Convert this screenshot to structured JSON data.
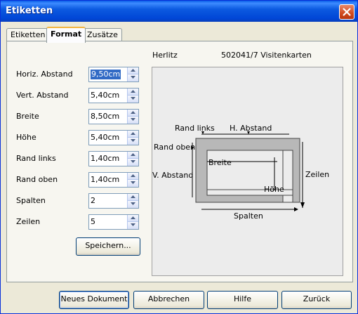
{
  "window": {
    "title": "Etiketten"
  },
  "tabs": [
    {
      "label": "Etiketten"
    },
    {
      "label": "Format"
    },
    {
      "label": "Zusätze"
    }
  ],
  "header": {
    "brand": "Herlitz",
    "product": "502041/7 Visitenkarten"
  },
  "fields": [
    {
      "label": "Horiz. Abstand",
      "value": "9,50cm"
    },
    {
      "label": "Vert. Abstand",
      "value": "5,40cm"
    },
    {
      "label": "Breite",
      "value": "8,50cm"
    },
    {
      "label": "Höhe",
      "value": "5,40cm"
    },
    {
      "label": "Rand links",
      "value": "1,40cm"
    },
    {
      "label": "Rand oben",
      "value": "1,40cm"
    },
    {
      "label": "Spalten",
      "value": "2"
    },
    {
      "label": "Zeilen",
      "value": "5"
    }
  ],
  "save_label": "Speichern...",
  "diagram": {
    "rand_links": "Rand links",
    "h_abstand": "H. Abstand",
    "rand_oben": "Rand oben",
    "v_abstand": "V. Abstand",
    "breite": "Breite",
    "hoehe": "Höhe",
    "zeilen": "Zeilen",
    "spalten": "Spalten"
  },
  "buttons": {
    "neues_dokument": "Neues Dokument",
    "abbrechen": "Abbrechen",
    "hilfe": "Hilfe",
    "zurueck": "Zurück"
  }
}
